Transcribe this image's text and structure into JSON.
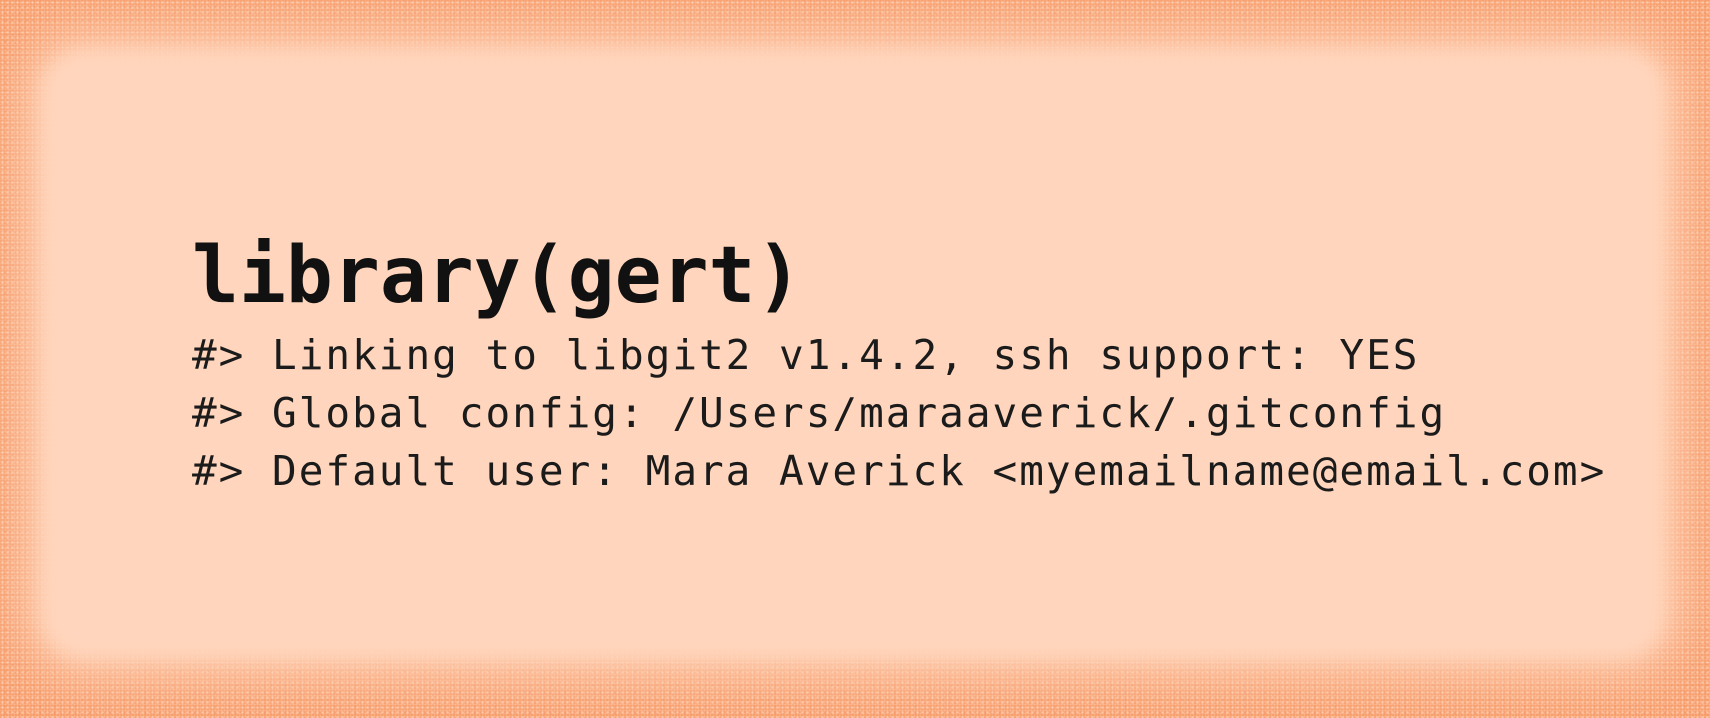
{
  "command": "library(gert)",
  "output_lines": [
    "#> Linking to libgit2 v1.4.2, ssh support: YES",
    "#> Global config: /Users/maraaverick/.gitconfig",
    "#> Default user: Mara Averick <myemailname@email.com>"
  ],
  "colors": {
    "border": "#f79a67",
    "panel": "#ffd6bd",
    "text": "#111111"
  }
}
